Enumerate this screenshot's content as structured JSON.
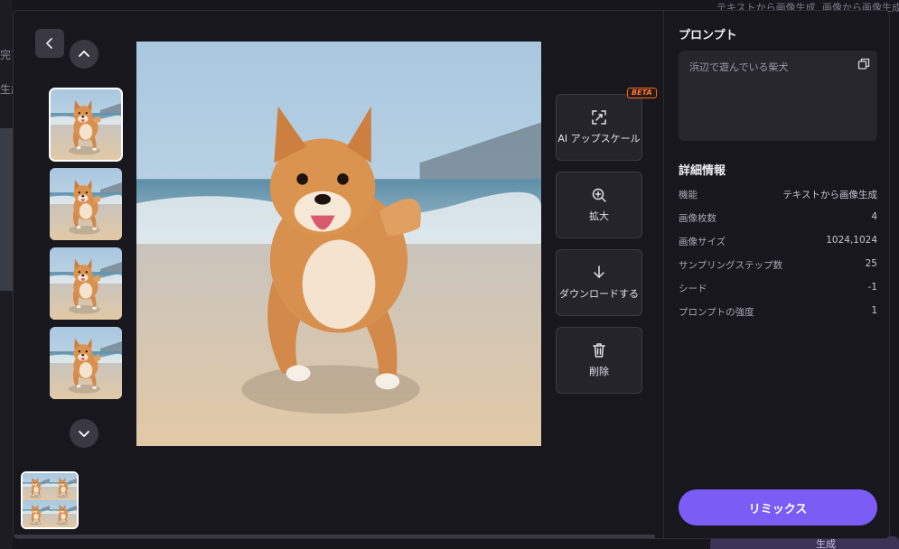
{
  "background": {
    "top_texts": [
      "テキストから画像生成",
      "画像から画像生成"
    ],
    "left_texts": [
      "完了",
      "生成"
    ],
    "bottom_button_label": "生成"
  },
  "viewer": {
    "tools": [
      {
        "label": "AI アップスケール",
        "icon": "upscale-icon",
        "badge": "BETA"
      },
      {
        "label": "拡大",
        "icon": "zoom-in-icon"
      },
      {
        "label": "ダウンロードする",
        "icon": "download-icon"
      },
      {
        "label": "削除",
        "icon": "trash-icon"
      }
    ],
    "thumbnail_count": 4,
    "selected_thumbnail": 1
  },
  "panel": {
    "prompt_title": "プロンプト",
    "prompt_text": "浜辺で遊んでいる柴犬",
    "details_title": "詳細情報",
    "details": [
      {
        "label": "機能",
        "value": "テキストから画像生成"
      },
      {
        "label": "画像枚数",
        "value": "4"
      },
      {
        "label": "画像サイズ",
        "value": "1024,1024"
      },
      {
        "label": "サンプリングステップ数",
        "value": "25"
      },
      {
        "label": "シード",
        "value": "-1"
      },
      {
        "label": "プロンプトの強度",
        "value": "1"
      }
    ],
    "remix_label": "リミックス"
  },
  "colors": {
    "accent": "#7b5cf5",
    "beta": "#ff7a3a",
    "panel_bg": "#18171d"
  }
}
